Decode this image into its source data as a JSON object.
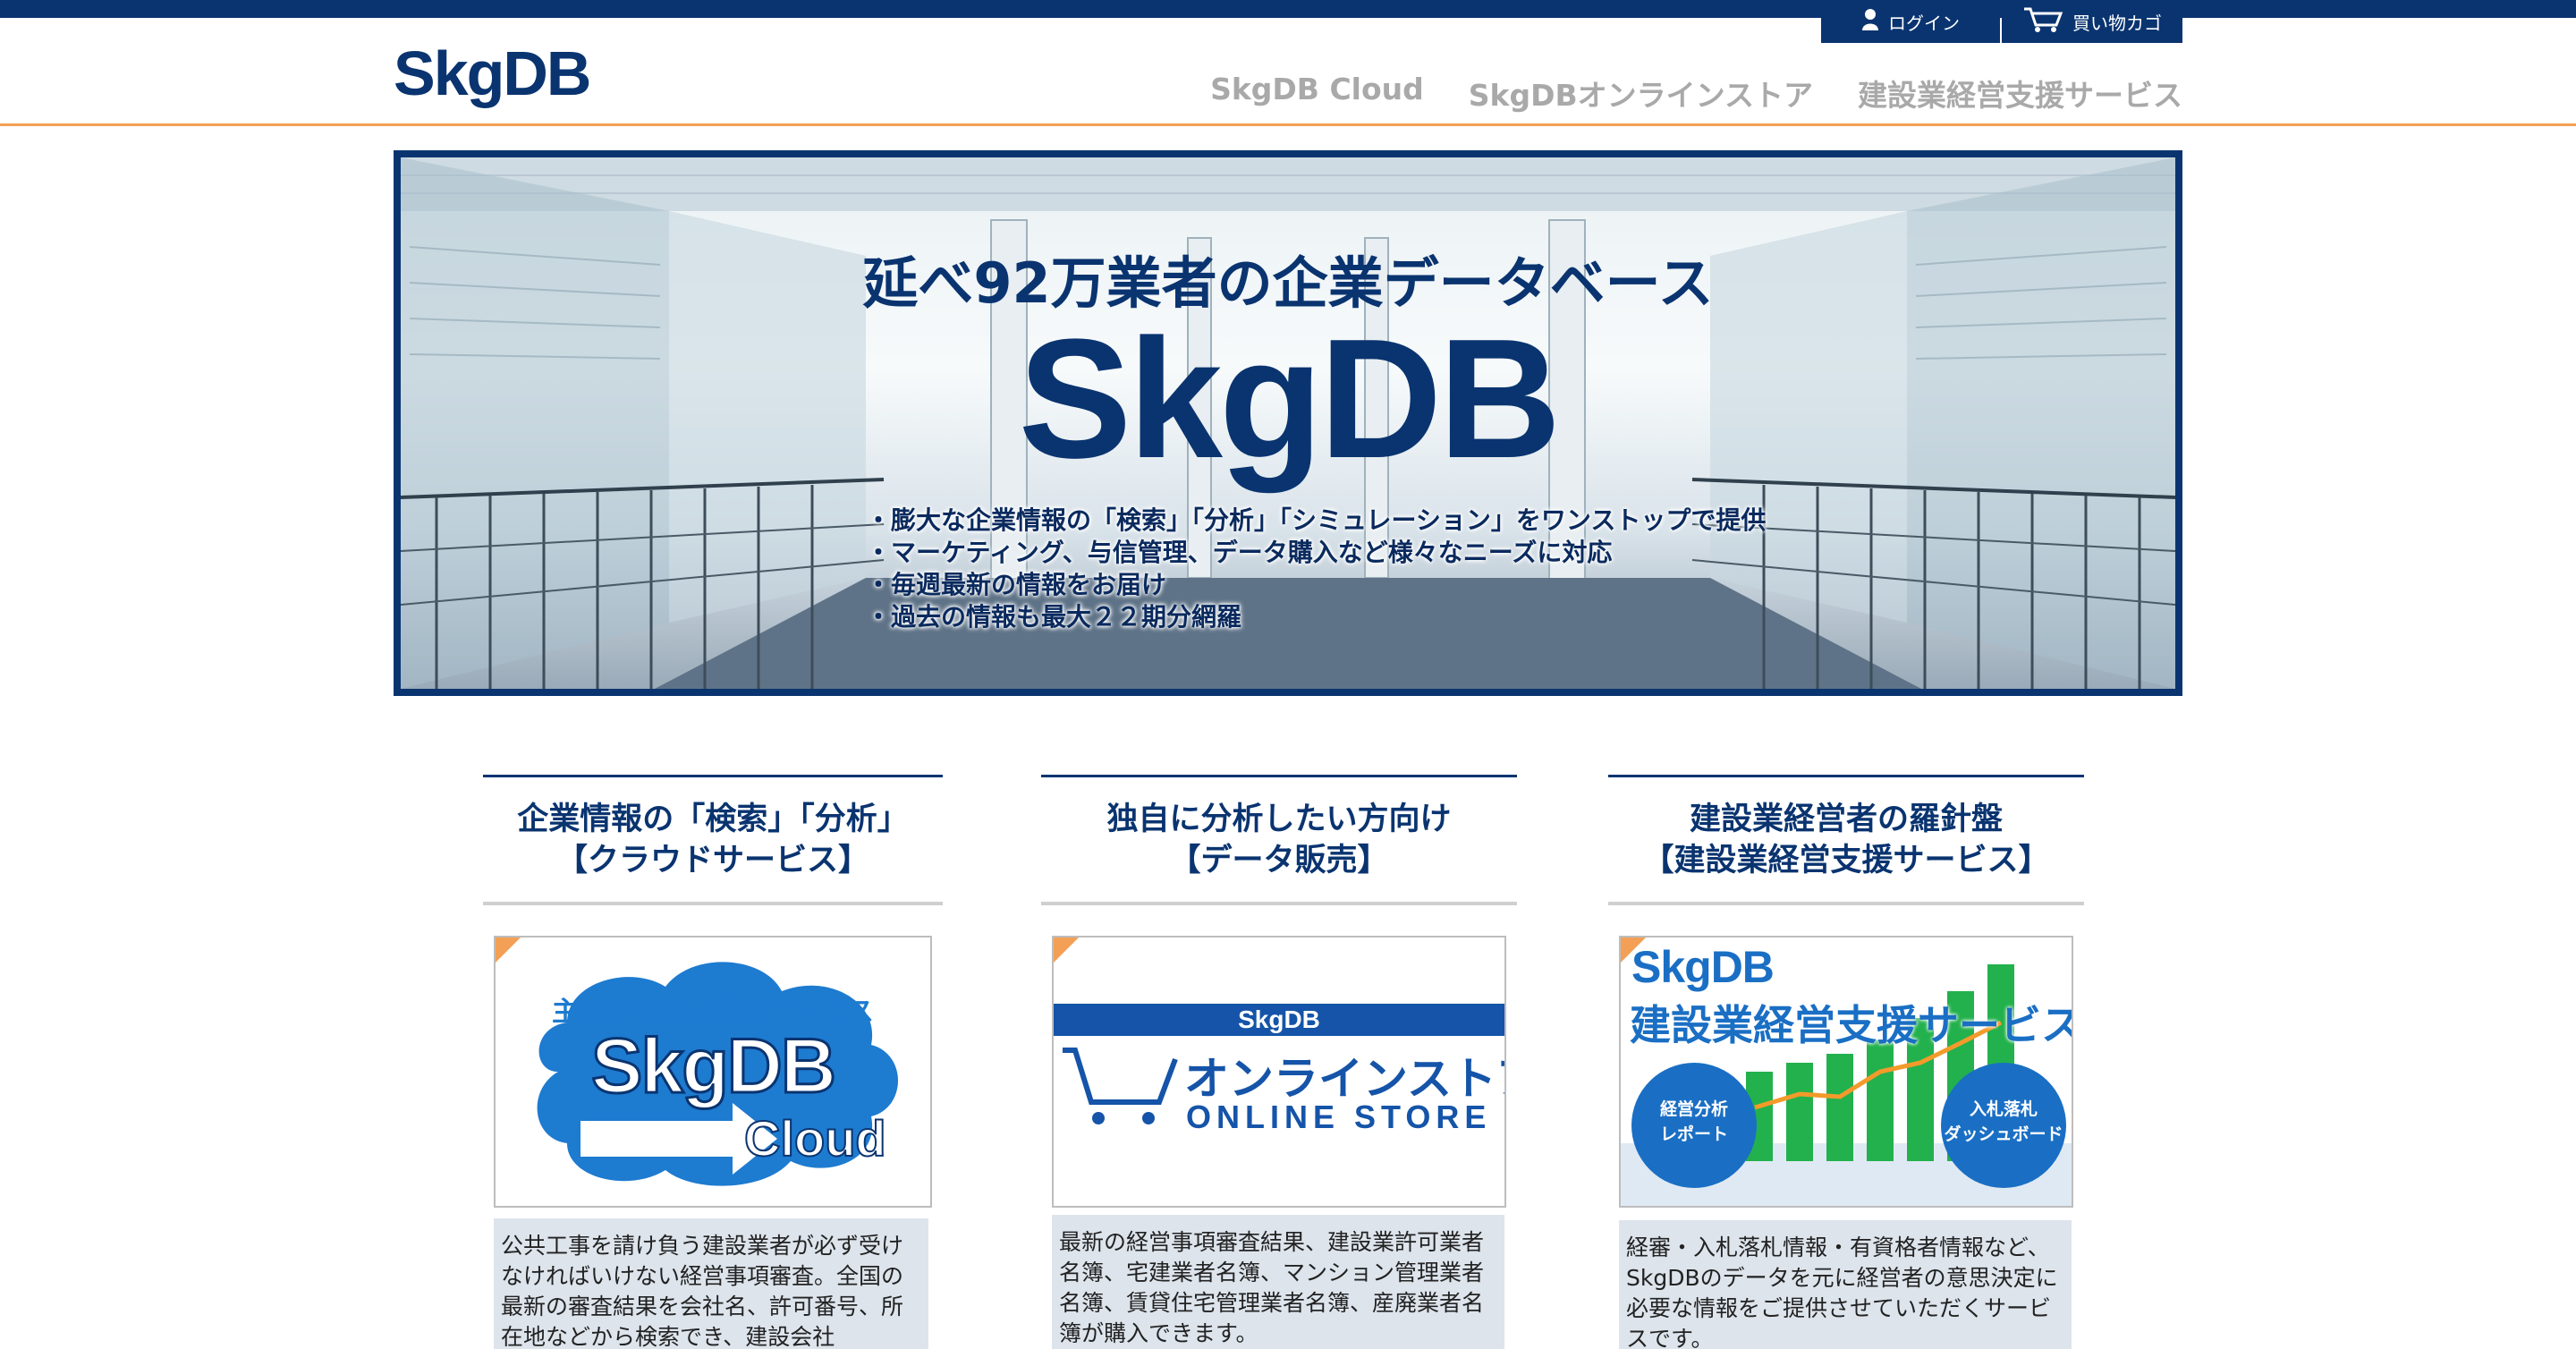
{
  "header": {
    "logo": "SkgDB",
    "login_label": "ログイン",
    "cart_label": "買い物カゴ",
    "nav": [
      "SkgDB Cloud",
      "SkgDBオンラインストア",
      "建設業経営支援サービス"
    ]
  },
  "hero": {
    "headline": "延べ92万業者の企業データベース",
    "brand": "SkgDB",
    "bullets": [
      "・膨大な企業情報の「検索」「分析」「シミュレーション」をワンストップで提供",
      "・マーケティング、与信管理、データ購入など様々なニーズに対応",
      "・毎週最新の情報をお届け",
      "・過去の情報も最大２２期分網羅"
    ]
  },
  "columns": [
    {
      "title_line1": "企業情報の「検索」「分析」",
      "title_line2": "【クラウドサービス】",
      "banner": {
        "caption": "主要建設業者総合サービス",
        "brand": "SkgDB",
        "sub": "Cloud"
      },
      "description": "公共工事を請け負う建設業者が必ず受けなければいけない経営事項審査。全国の最新の審査結果を会社名、許可番号、所在地などから検索でき、建設会社"
    },
    {
      "title_line1": "独自に分析したい方向け",
      "title_line2": "【データ販売】",
      "banner": {
        "bar": "SkgDB",
        "title": "オンラインストア",
        "sub": "ONLINE STORE"
      },
      "description": "最新の経営事項審査結果、建設業許可業者名簿、宅建業者名簿、マンション管理業者名簿、賃貸住宅管理業者名簿、産廃業者名簿が購入できます。"
    },
    {
      "title_line1": "建設業経営者の羅針盤",
      "title_line2": "【建設業経営支援サービス】",
      "banner": {
        "brand": "SkgDB",
        "title": "建設業経営支援サービス",
        "badge_left": "経営分析\nレポート",
        "badge_right": "入札落札\nダッシュボード"
      },
      "description": "経審・入札落札情報・有資格者情報など、SkgDBのデータを元に経営者の意思決定に必要な情報をご提供させていただくサービスです。"
    }
  ],
  "colors": {
    "navy": "#0a3470",
    "orange": "#f3a056",
    "nav_gray": "#a9a9a9",
    "desc_bg": "#dde4ec",
    "cloud_blue": "#1d7bd0"
  }
}
